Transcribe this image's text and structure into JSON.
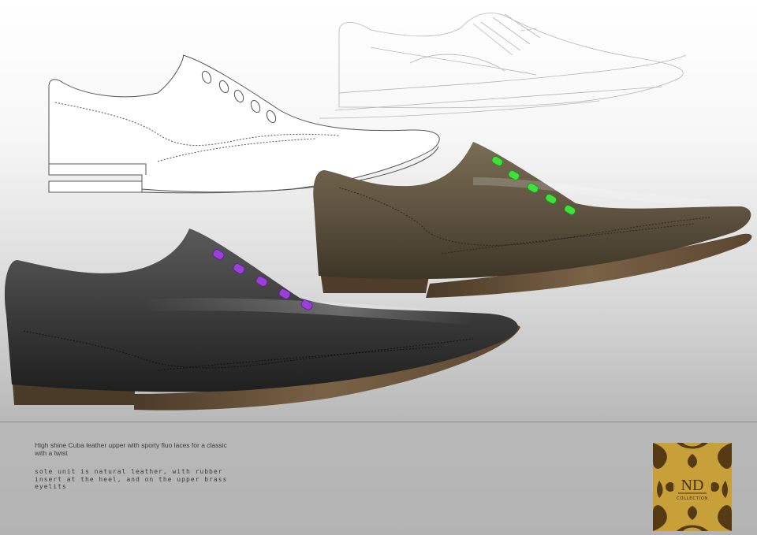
{
  "description": {
    "headline": "High shine Cuba leather upper with sporty fluo laces for a classic with a twist",
    "detail": "sole unit is natural leather, with rubber insert at the heel, and on the upper brass eyelits"
  },
  "logo": {
    "initials": "ND",
    "label": "COLLECTION"
  },
  "colors": {
    "black_shoe": "#3a3a3a",
    "brown_shoe": "#5e5340",
    "purple_laces": "#9a3fd8",
    "green_laces": "#3ee03a",
    "sole_wood": "#6b5338",
    "logo_gold": "#c7a03a",
    "logo_brown": "#4a3010"
  }
}
